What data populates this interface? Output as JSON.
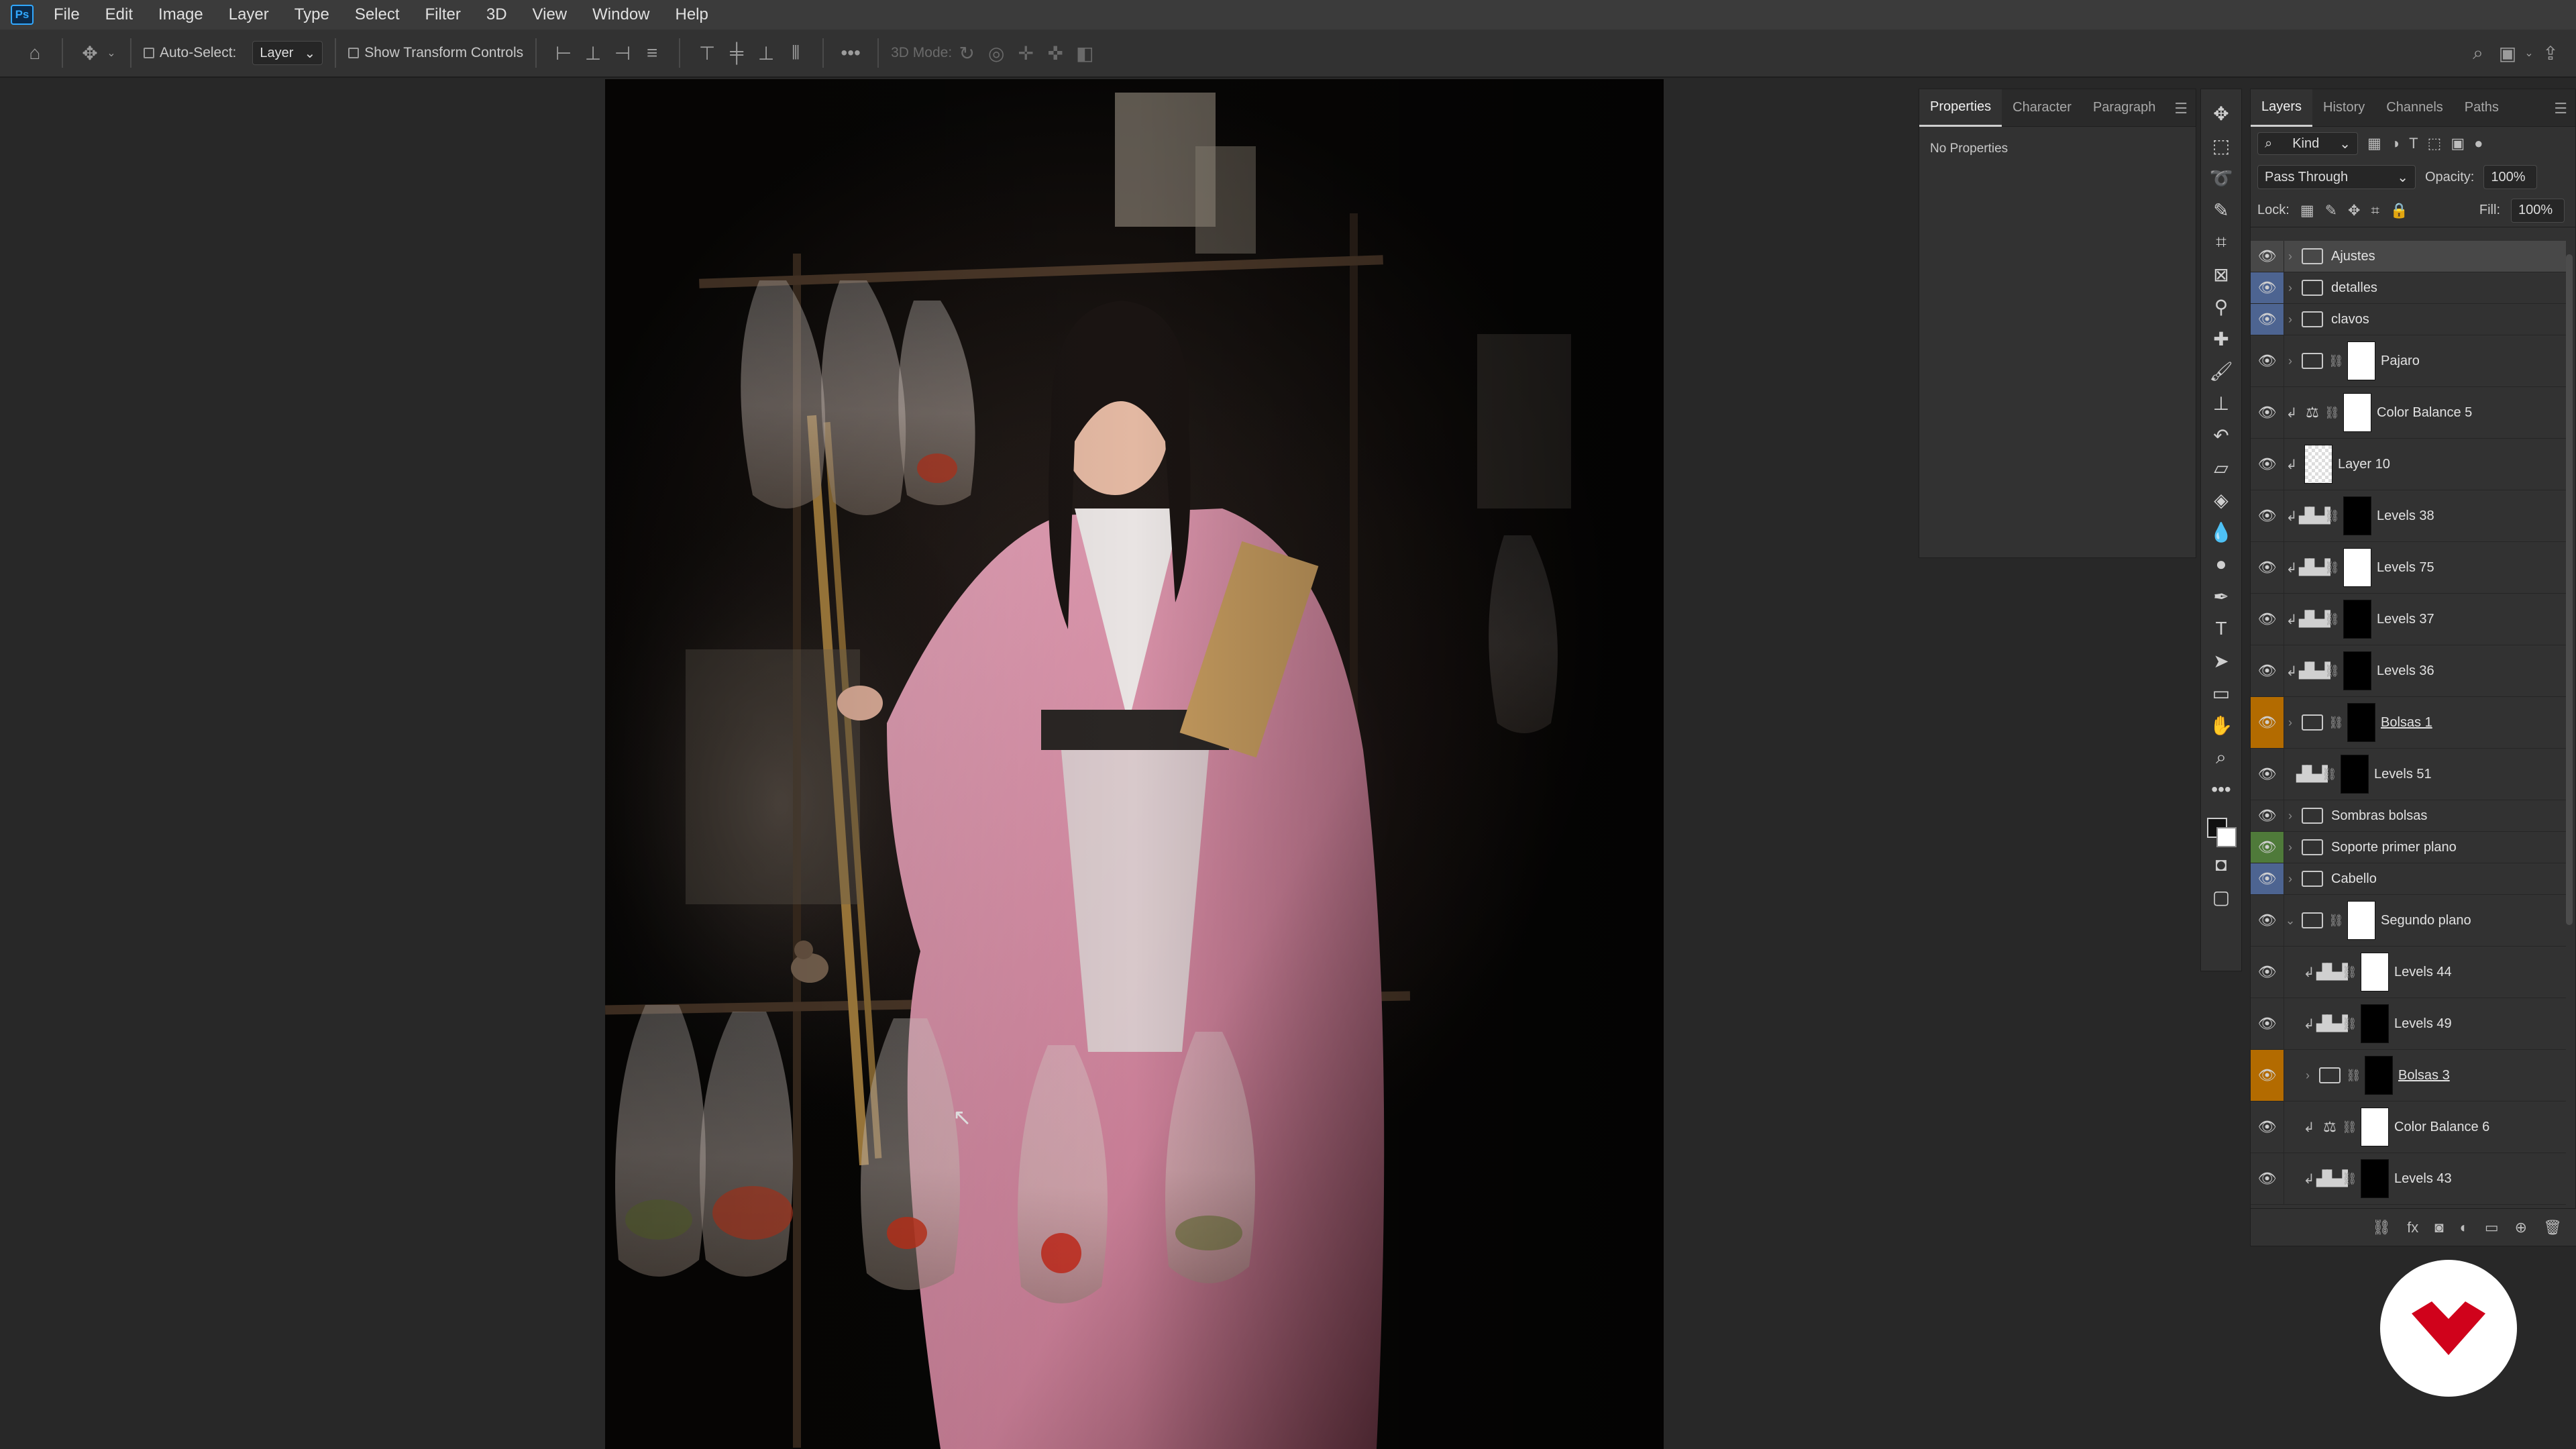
{
  "menu": {
    "items": [
      "File",
      "Edit",
      "Image",
      "Layer",
      "Type",
      "Select",
      "Filter",
      "3D",
      "View",
      "Window",
      "Help"
    ]
  },
  "options": {
    "auto_select_label": "Auto-Select:",
    "auto_select_target": "Layer",
    "show_transform_label": "Show Transform Controls",
    "mode_3d_label": "3D Mode:"
  },
  "properties": {
    "tabs": [
      "Properties",
      "Character",
      "Paragraph"
    ],
    "content": "No Properties"
  },
  "layers_panel": {
    "tabs": [
      "Layers",
      "History",
      "Channels",
      "Paths"
    ],
    "filter": "Kind",
    "blend_mode": "Pass Through",
    "opacity_label": "Opacity:",
    "opacity": "100%",
    "lock_label": "Lock:",
    "fill_label": "Fill:",
    "fill": "100%",
    "layers": [
      {
        "name": "Ajustes",
        "type": "group",
        "eye": "default",
        "selected": true
      },
      {
        "name": "detalles",
        "type": "group",
        "eye": "blue"
      },
      {
        "name": "clavos",
        "type": "group",
        "eye": "blue"
      },
      {
        "name": "Pajaro",
        "type": "group-mask",
        "eye": "default",
        "thumb": "white"
      },
      {
        "name": "Color Balance 5",
        "type": "adjust",
        "eye": "default",
        "clip": true,
        "icon": "balance",
        "thumb": "white"
      },
      {
        "name": "Layer 10",
        "type": "pixel",
        "eye": "default",
        "clip": true,
        "thumb": "transparent"
      },
      {
        "name": "Levels 38",
        "type": "adjust",
        "eye": "default",
        "clip": true,
        "icon": "levels",
        "thumb": "black"
      },
      {
        "name": "Levels 75",
        "type": "adjust",
        "eye": "default",
        "clip": true,
        "icon": "levels",
        "thumb": "white"
      },
      {
        "name": "Levels 37",
        "type": "adjust",
        "eye": "default",
        "clip": true,
        "icon": "levels",
        "thumb": "black"
      },
      {
        "name": "Levels 36",
        "type": "adjust",
        "eye": "default",
        "clip": true,
        "icon": "levels",
        "thumb": "black"
      },
      {
        "name": "Bolsas 1",
        "type": "group-mask",
        "eye": "orange",
        "thumb": "black",
        "underline": true
      },
      {
        "name": "Levels 51",
        "type": "adjust",
        "eye": "default",
        "icon": "levels",
        "thumb": "black"
      },
      {
        "name": "Sombras bolsas",
        "type": "group",
        "eye": "default"
      },
      {
        "name": "Soporte primer plano",
        "type": "group",
        "eye": "green"
      },
      {
        "name": "Cabello",
        "type": "group",
        "eye": "blue"
      },
      {
        "name": "Segundo plano",
        "type": "group-mask",
        "eye": "default",
        "open": true,
        "thumb": "white"
      },
      {
        "name": "Levels 44",
        "type": "adjust",
        "eye": "default",
        "clip": true,
        "indent": true,
        "icon": "levels",
        "thumb": "white"
      },
      {
        "name": "Levels 49",
        "type": "adjust",
        "eye": "default",
        "clip": true,
        "indent": true,
        "icon": "levels",
        "thumb": "black"
      },
      {
        "name": "Bolsas 3",
        "type": "group-mask",
        "eye": "orange",
        "indent": true,
        "thumb": "black",
        "underline": true
      },
      {
        "name": "Color Balance 6",
        "type": "adjust",
        "eye": "default",
        "clip": true,
        "indent": true,
        "icon": "balance",
        "thumb": "white"
      },
      {
        "name": "Levels 43",
        "type": "adjust",
        "eye": "default",
        "clip": true,
        "indent": true,
        "icon": "levels",
        "thumb": "black"
      }
    ]
  },
  "colors": {
    "eye_blue": "#4d6491",
    "eye_green": "#4f7a3a",
    "eye_orange": "#b36b00",
    "brand_red": "#d0021b",
    "kimono_pink": "#d78fa6"
  }
}
